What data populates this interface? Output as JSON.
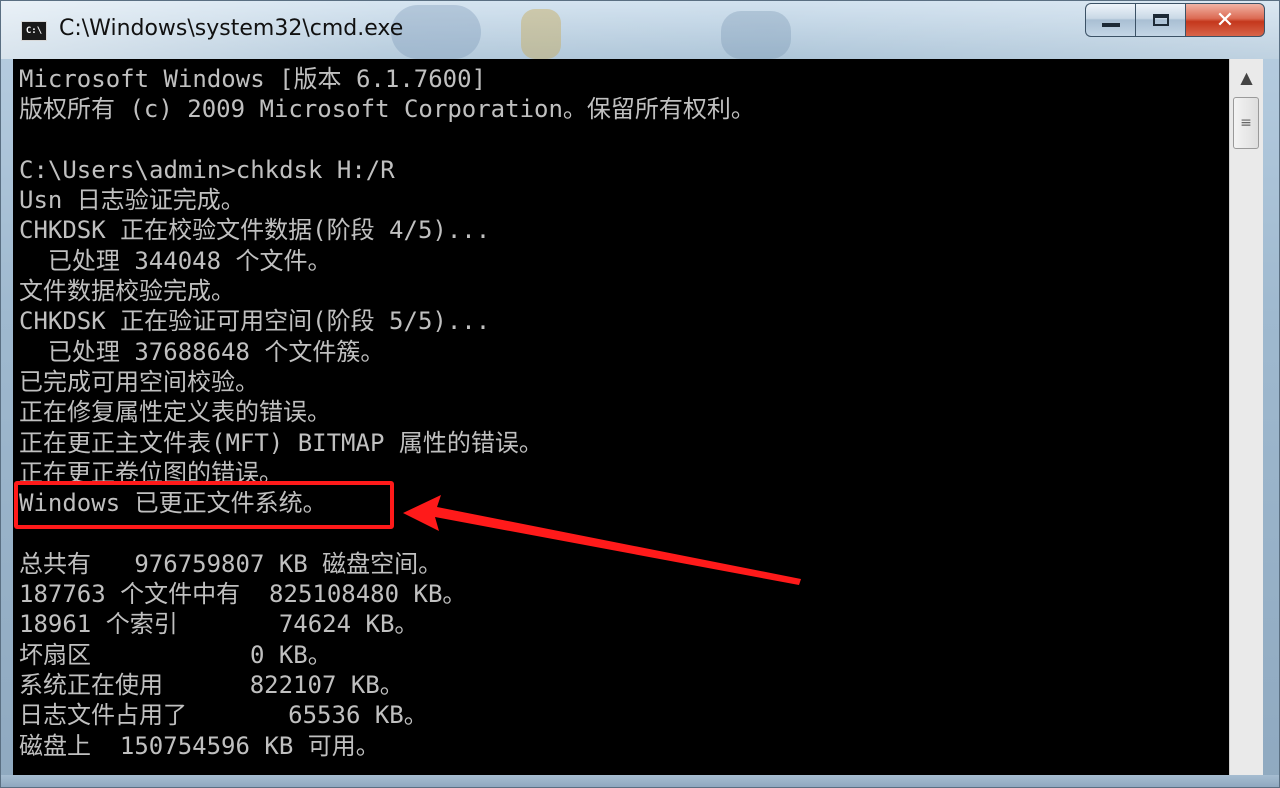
{
  "window": {
    "title": "C:\\Windows\\system32\\cmd.exe",
    "icon_label": "C:\\",
    "close_symbol": "✕"
  },
  "console": {
    "lines": [
      "Microsoft Windows [版本 6.1.7600]",
      "版权所有 (c) 2009 Microsoft Corporation。保留所有权利。",
      "",
      "C:\\Users\\admin>chkdsk H:/R",
      "Usn 日志验证完成。",
      "CHKDSK 正在校验文件数据(阶段 4/5)...",
      "  已处理 344048 个文件。",
      "文件数据校验完成。",
      "CHKDSK 正在验证可用空间(阶段 5/5)...",
      "  已处理 37688648 个文件簇。",
      "已完成可用空间校验。",
      "正在修复属性定义表的错误。",
      "正在更正主文件表(MFT) BITMAP 属性的错误。",
      "正在更正卷位图的错误。",
      "Windows 已更正文件系统。",
      "",
      "总共有   976759807 KB 磁盘空间。",
      "187763 个文件中有  825108480 KB。",
      "18961 个索引       74624 KB。",
      "坏扇区           0 KB。",
      "系统正在使用      822107 KB。",
      "日志文件占用了       65536 KB。",
      "磁盘上  150754596 KB 可用。"
    ]
  },
  "annotation": {
    "color": "#ff1a1a"
  },
  "scrollbar": {
    "up_symbol": "▲",
    "thumb_grip": "≡"
  }
}
